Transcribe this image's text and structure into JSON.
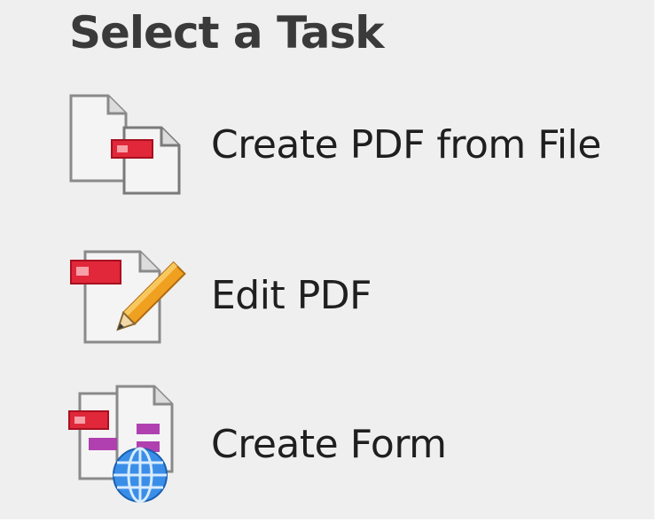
{
  "panel": {
    "title": "Select a Task",
    "tasks": [
      {
        "label": "Create PDF from File",
        "icon": "create-pdf-from-file-icon"
      },
      {
        "label": "Edit PDF",
        "icon": "edit-pdf-icon"
      },
      {
        "label": "Create Form",
        "icon": "create-form-icon"
      }
    ]
  },
  "colors": {
    "panel_background": "#efefef",
    "pdf_red": "#e0283a",
    "form_magenta": "#b040b0",
    "globe_blue": "#3a8ee8",
    "pencil_orange": "#f0a020"
  }
}
